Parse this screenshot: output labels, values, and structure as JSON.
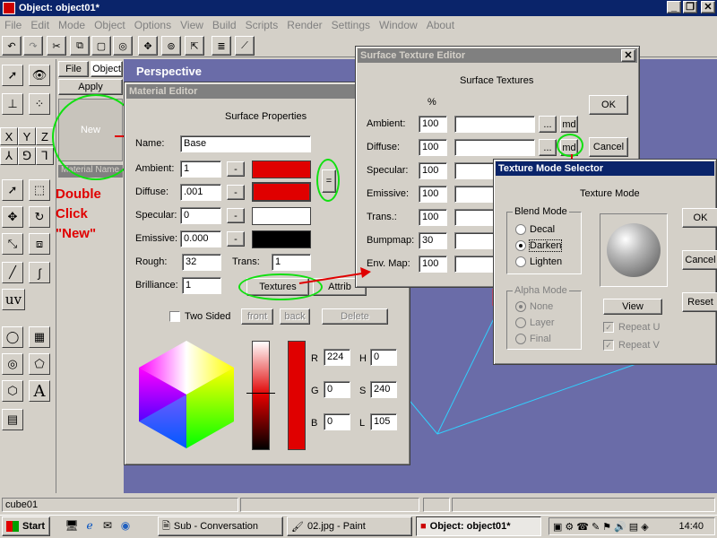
{
  "app": {
    "title": "Object: object01*",
    "menus": [
      "File",
      "Edit",
      "Mode",
      "Object",
      "Options",
      "View",
      "Build",
      "Scripts",
      "Render",
      "Settings",
      "Window",
      "About"
    ],
    "status_text": "cube01"
  },
  "left_panel": {
    "file_btn": "File",
    "object_btn": "Object",
    "apply_btn": "Apply",
    "new_label": "New",
    "material_name": "Material Name",
    "axis_x": "X",
    "axis_y": "Y",
    "axis_z": "Z",
    "uv_label": "uv",
    "text_tool": "A"
  },
  "viewport": {
    "label": "Perspective"
  },
  "annotation": {
    "line1": "Double",
    "line2": "Click",
    "line3": "\"New\""
  },
  "material_editor": {
    "title": "Material Editor",
    "heading": "Surface Properties",
    "name_label": "Name:",
    "name_value": "Base",
    "ambient_label": "Ambient:",
    "ambient_value": "1",
    "diffuse_label": "Diffuse:",
    "diffuse_value": ".001",
    "specular_label": "Specular:",
    "specular_value": "0",
    "emissive_label": "Emissive:",
    "emissive_value": "0.000",
    "rough_label": "Rough:",
    "rough_value": "32",
    "trans_label": "Trans:",
    "trans_value": "1",
    "brilliance_label": "Brilliance:",
    "brilliance_value": "1",
    "minus": "-",
    "equals": "=",
    "textures_btn": "Textures",
    "attrib_btn": "Attrib",
    "two_sided_label": "Two Sided",
    "front_btn": "front",
    "back_btn": "back",
    "delete_btn": "Delete",
    "r_label": "R",
    "r_value": "224",
    "g_label": "G",
    "g_value": "0",
    "b_label": "B",
    "b_value": "0",
    "h_label": "H",
    "h_value": "0",
    "s_label": "S",
    "s_value": "240",
    "l_label": "L",
    "l_value": "105",
    "colors": {
      "ambient": "#e00000",
      "diffuse": "#e00000",
      "specular": "#ffffff",
      "emissive": "#000000"
    }
  },
  "texture_editor": {
    "title": "Surface Texture Editor",
    "heading": "Surface Textures",
    "pct": "%",
    "rows": [
      {
        "label": "Ambient:",
        "value": "100"
      },
      {
        "label": "Diffuse:",
        "value": "100"
      },
      {
        "label": "Specular:",
        "value": "100"
      },
      {
        "label": "Emissive:",
        "value": "100"
      },
      {
        "label": "Trans.:",
        "value": "100"
      },
      {
        "label": "Bumpmap:",
        "value": "30"
      },
      {
        "label": "Env. Map:",
        "value": "100"
      }
    ],
    "dots_btn": "...",
    "md_btn": "md",
    "ok_btn": "OK",
    "cancel_btn": "Cancel"
  },
  "mode_selector": {
    "title": "Texture Mode Selector",
    "heading": "Texture Mode",
    "blend_group": "Blend Mode",
    "blend": [
      "Decal",
      "Darken",
      "Lighten"
    ],
    "alpha_group": "Alpha Mode",
    "alpha": [
      "None",
      "Layer",
      "Final"
    ],
    "view_btn": "View",
    "repeat_u": "Repeat U",
    "repeat_v": "Repeat V",
    "ok_btn": "OK",
    "cancel_btn": "Cancel",
    "reset_btn": "Reset"
  },
  "taskbar": {
    "start": "Start",
    "items": [
      "Sub - Conversation",
      "02.jpg - Paint",
      "Object: object01*"
    ],
    "clock": "14:40"
  }
}
